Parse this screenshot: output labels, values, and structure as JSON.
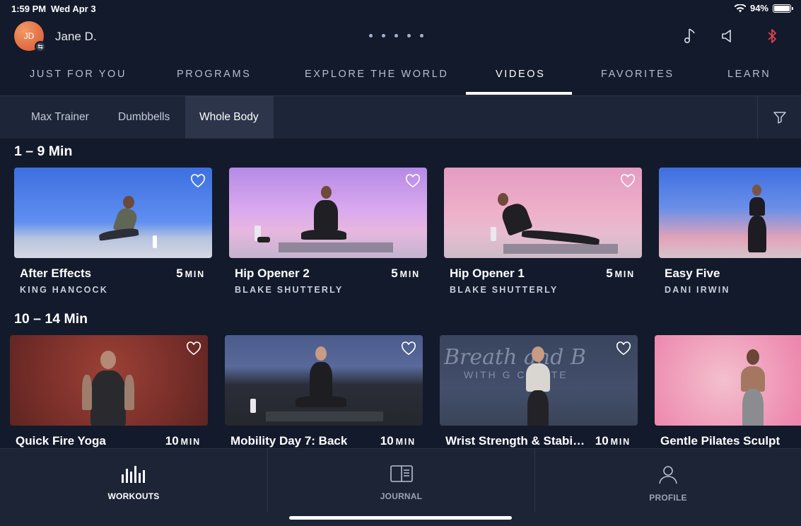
{
  "status_bar": {
    "time": "1:59 PM",
    "date": "Wed Apr 3",
    "battery": "94%"
  },
  "header": {
    "avatar_initials": "JD",
    "user_name": "Jane D.",
    "icons": [
      "music-note-icon",
      "speaker-icon",
      "bluetooth-icon"
    ]
  },
  "main_nav": {
    "tabs": [
      {
        "label": "JUST FOR YOU",
        "active": false
      },
      {
        "label": "PROGRAMS",
        "active": false
      },
      {
        "label": "EXPLORE THE WORLD",
        "active": false
      },
      {
        "label": "VIDEOS",
        "active": true
      },
      {
        "label": "FAVORITES",
        "active": false
      },
      {
        "label": "LEARN",
        "active": false
      }
    ]
  },
  "sub_nav": {
    "chips": [
      {
        "label": "Max Trainer",
        "active": false
      },
      {
        "label": "Dumbbells",
        "active": false
      },
      {
        "label": "Whole Body",
        "active": true
      }
    ]
  },
  "sections": [
    {
      "title": "1 – 9 Min",
      "cards": [
        {
          "title": "After Effects",
          "duration": "5",
          "unit": "MIN",
          "coach": "KING HANCOCK"
        },
        {
          "title": "Hip Opener 2",
          "duration": "5",
          "unit": "MIN",
          "coach": "BLAKE SHUTTERLY"
        },
        {
          "title": "Hip Opener 1",
          "duration": "5",
          "unit": "MIN",
          "coach": "BLAKE SHUTTERLY"
        },
        {
          "title": "Easy Five",
          "duration": "",
          "unit": "",
          "coach": "DANI IRWIN"
        }
      ]
    },
    {
      "title": "10 – 14 Min",
      "cards": [
        {
          "title": "Quick Fire Yoga",
          "duration": "10",
          "unit": "MIN",
          "coach": ""
        },
        {
          "title": "Mobility Day 7: Back",
          "duration": "10",
          "unit": "MIN",
          "coach": ""
        },
        {
          "title": "Wrist Strength & Stabil...",
          "duration": "10",
          "unit": "MIN",
          "coach": ""
        },
        {
          "title": "Gentle Pilates Sculpt",
          "duration": "",
          "unit": "",
          "coach": ""
        }
      ]
    }
  ],
  "thumbnail_text": {
    "breathe_overlay_line1": "Breath   and B",
    "breathe_overlay_line2": "WITH G   CULATE"
  },
  "bottom_tabs": [
    {
      "label": "WORKOUTS",
      "active": true
    },
    {
      "label": "JOURNAL",
      "active": false
    },
    {
      "label": "PROFILE",
      "active": false
    }
  ],
  "colors": {
    "background": "#131a2b",
    "surface": "#1d2538",
    "active_chip": "#2c3549",
    "bluetooth": "#e0424f",
    "avatar": "#e0653a"
  }
}
